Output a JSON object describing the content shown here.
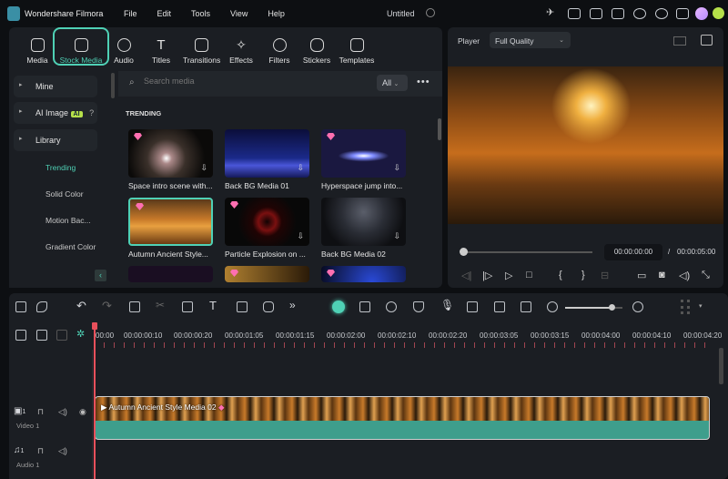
{
  "app": {
    "name": "Wondershare Filmora",
    "project_title": "Untitled"
  },
  "menu": [
    "File",
    "Edit",
    "Tools",
    "View",
    "Help"
  ],
  "toolbar_tabs": [
    {
      "label": "Media"
    },
    {
      "label": "Stock Media",
      "active": true
    },
    {
      "label": "Audio"
    },
    {
      "label": "Titles"
    },
    {
      "label": "Transitions"
    },
    {
      "label": "Effects"
    },
    {
      "label": "Filters"
    },
    {
      "label": "Stickers"
    },
    {
      "label": "Templates"
    }
  ],
  "sidebar": {
    "groups": [
      {
        "label": "Mine"
      },
      {
        "label": "AI Image",
        "badge": "AI"
      },
      {
        "label": "Library"
      }
    ],
    "library_items": [
      {
        "label": "Trending",
        "active": true
      },
      {
        "label": "Solid Color"
      },
      {
        "label": "Motion Bac..."
      },
      {
        "label": "Gradient Color"
      }
    ]
  },
  "search": {
    "placeholder": "Search media",
    "filter": "All"
  },
  "section_title": "TRENDING",
  "media": [
    {
      "label": "Space intro scene with...",
      "premium": true
    },
    {
      "label": "Back BG Media 01",
      "premium": false
    },
    {
      "label": "Hyperspace jump into...",
      "premium": true
    },
    {
      "label": "Autumn Ancient Style...",
      "premium": true,
      "selected": true
    },
    {
      "label": "Particle Explosion on ...",
      "premium": true
    },
    {
      "label": "Back BG Media 02",
      "premium": false
    }
  ],
  "player": {
    "label": "Player",
    "quality": "Full Quality",
    "current_time": "00:00:00:00",
    "separator": "/",
    "total_time": "00:00:05:00",
    "progress": 0
  },
  "timeline": {
    "ruler": [
      "00:00",
      "00:00:00:10",
      "00:00:00:20",
      "00:00:01:05",
      "00:00:01:15",
      "00:00:02:00",
      "00:00:02:10",
      "00:00:02:20",
      "00:00:03:05",
      "00:00:03:15",
      "00:00:04:00",
      "00:00:04:10",
      "00:00:04:20"
    ],
    "zoom": 0.85,
    "tracks": [
      {
        "label": "Video 1",
        "num": "1"
      },
      {
        "label": "Audio 1",
        "num": "1"
      }
    ],
    "clip": {
      "label": "Autumn Ancient Style Media 02"
    }
  },
  "colors": {
    "accent": "#4fd1b5",
    "clip": "#3e9e8c",
    "playhead": "#e8505b"
  }
}
